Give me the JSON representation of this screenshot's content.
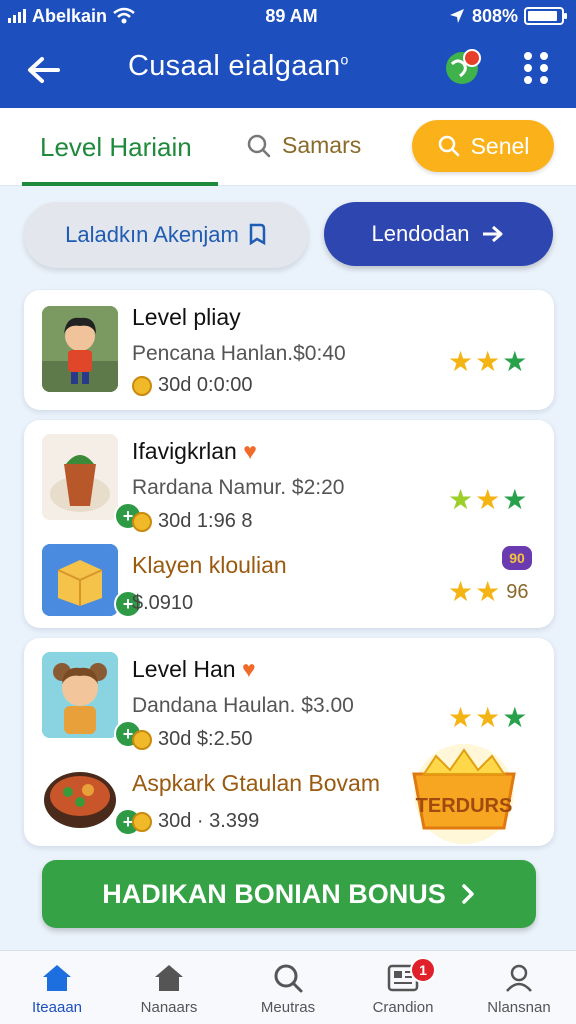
{
  "status_bar": {
    "carrier": "Abelkain",
    "time": "89 AM",
    "battery": "808%"
  },
  "header": {
    "title": "Cusaal eialgaan"
  },
  "tabs": {
    "level": "Level Hariain",
    "search": "Samars",
    "senel": "Senel"
  },
  "actions": {
    "secondary": "Laladkın Akenjam",
    "primary": "Lendodan"
  },
  "card1": {
    "items": [
      {
        "title": "Level pliay",
        "subtitle": "Pencana Hanlan.$0:40",
        "meta": "30d 0:0:00"
      }
    ]
  },
  "card2": {
    "items": [
      {
        "title": "Ifavigkrlan",
        "subtitle": "Rardana Namur. $2:20",
        "meta": "30d 1:96 8"
      },
      {
        "title": "Klayen kloulian",
        "subtitle": "",
        "meta": "$.0910",
        "extra": "96",
        "badge": "90"
      }
    ]
  },
  "card3": {
    "items": [
      {
        "title": "Level Han",
        "subtitle": "Dandana Haulan. $3.00",
        "meta": "30d  $:2.50"
      },
      {
        "title": "Aspkark Gtaulan Bovam",
        "subtitle": "",
        "meta": "30d · 3.399"
      }
    ],
    "promo_label": "TERDURS"
  },
  "cta": {
    "label": "HADIKAN BONIAN BONUS"
  },
  "bottom_nav": {
    "items": [
      {
        "label": "Iteaaan"
      },
      {
        "label": "Nanaars"
      },
      {
        "label": "Meutras"
      },
      {
        "label": "Crandion",
        "badge": "1"
      },
      {
        "label": "Nlansnan"
      }
    ]
  },
  "colors": {
    "header_bg": "#1d4fbf",
    "accent_green": "#34a245",
    "accent_orange": "#fbb21a",
    "primary_blue": "#2d46b0"
  }
}
